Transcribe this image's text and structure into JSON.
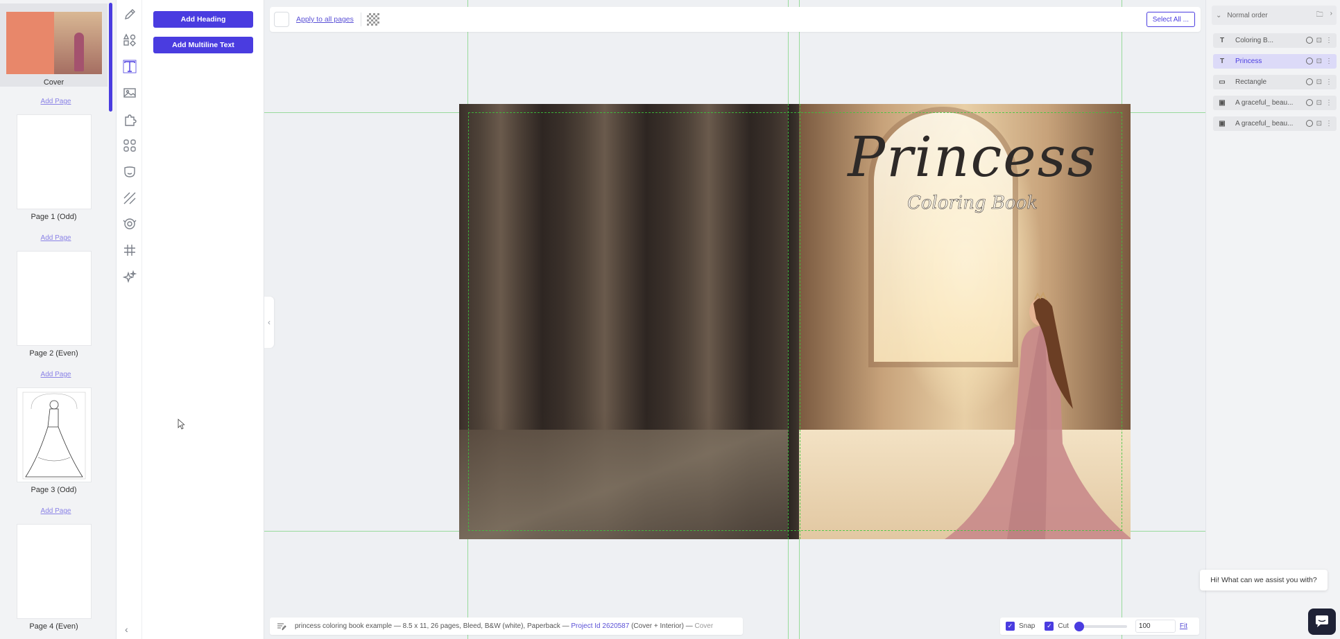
{
  "pages_sidebar": {
    "pages": [
      {
        "label": "Cover",
        "kind": "cover"
      },
      {
        "label": "Page 1 (Odd)",
        "kind": "blank"
      },
      {
        "label": "Page 2 (Even)",
        "kind": "blank"
      },
      {
        "label": "Page 3 (Odd)",
        "kind": "sketch"
      },
      {
        "label": "Page 4 (Even)",
        "kind": "blank"
      }
    ],
    "add_page_label": "Add Page",
    "collapse_icon": "chevron-left-icon"
  },
  "tool_rail": {
    "tools": [
      "pencil-icon",
      "shapes-icon",
      "text-icon",
      "image-icon",
      "puzzle-icon",
      "elements-icon",
      "mask-icon",
      "pattern-icon",
      "sticker-icon",
      "grid-icon",
      "magic-icon"
    ],
    "active": "text-icon"
  },
  "text_panel": {
    "add_heading_label": "Add Heading",
    "add_multiline_label": "Add Multiline Text"
  },
  "toolbar": {
    "apply_all_label": "Apply to all pages",
    "select_all_label": "Select All ..."
  },
  "canvas": {
    "cover_title": "Princess",
    "cover_subtitle": "Coloring Book"
  },
  "infobar": {
    "project_desc": "princess coloring book example — 8.5 x 11, 26 pages, Bleed, B&W (white), Paperback —",
    "project_id": "Project Id 2620587",
    "project_tail": "(Cover + Interior) —",
    "current_page": "Cover"
  },
  "zoombar": {
    "snap_label": "Snap",
    "cut_label": "Cut",
    "zoom_value": "100",
    "fit_label": "Fit"
  },
  "layers": {
    "order_label": "Normal order",
    "items": [
      {
        "type_symbol": "T",
        "name": "Coloring B...",
        "selected": false
      },
      {
        "type_symbol": "T",
        "name": "Princess",
        "selected": true
      },
      {
        "type_symbol": "▭",
        "name": "Rectangle",
        "selected": false
      },
      {
        "type_symbol": "▣",
        "name": "A graceful_ beau...",
        "selected": false
      },
      {
        "type_symbol": "▣",
        "name": "A graceful_ beau...",
        "selected": false
      }
    ]
  },
  "chat": {
    "message": "Hi! What can we assist you with?"
  },
  "colors": {
    "accent": "#4a3ce0",
    "selected_layer_bg": "#dcdaf8",
    "guide": "#50c850",
    "cover_thumb_bg": "#e8876a"
  }
}
